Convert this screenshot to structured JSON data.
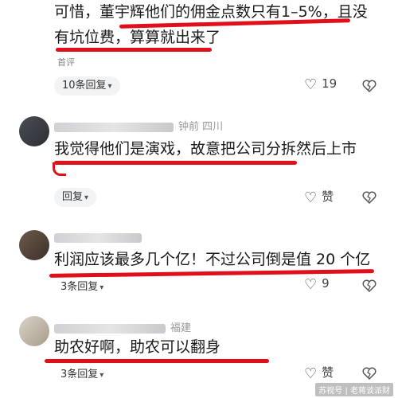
{
  "comments": [
    {
      "text_line1": "可惜，董宇辉他们的佣金点数只有1–5%，且没",
      "text_line2": "有坑位费，算算就出来了",
      "tag": "首评",
      "reply_label": "10条回复",
      "likes": "19"
    },
    {
      "meta_tail": "钟前 四川",
      "text": "我觉得他们是演戏，故意把公司分拆然后上市",
      "reply_label": "回复",
      "likes": "赞"
    },
    {
      "text": "利润应该最多几个亿！不过公司倒是值 20 个亿",
      "reply_label": "3条回复",
      "likes": "9"
    },
    {
      "meta_tail": "福建",
      "text": "助农好啊，助农可以翻身",
      "reply_label": "3条回复",
      "likes": "赞"
    }
  ],
  "watermark": "苏视号 | 老蒋谈派财",
  "colors": {
    "highlight": "#e0101a",
    "pill_bg": "#f2f3f5",
    "meta": "#999999"
  }
}
